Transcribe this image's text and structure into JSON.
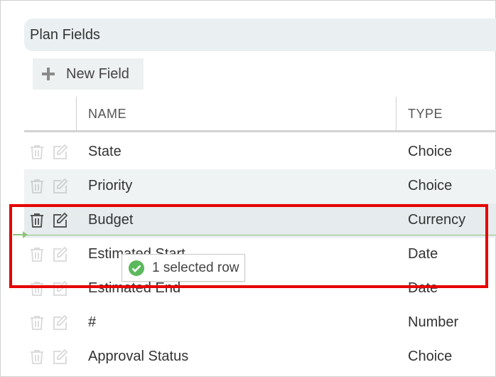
{
  "section": {
    "title": "Plan Fields"
  },
  "toolbar": {
    "new_field_label": "New Field"
  },
  "table": {
    "columns": [
      {
        "label": "NAME"
      },
      {
        "label": "TYPE"
      }
    ],
    "rows": [
      {
        "name": "State",
        "type": "Choice"
      },
      {
        "name": "Priority",
        "type": "Choice"
      },
      {
        "name": "Budget",
        "type": "Currency"
      },
      {
        "name": "Estimated Start",
        "type": "Date"
      },
      {
        "name": "Estimated End",
        "type": "Date"
      },
      {
        "name": "#",
        "type": "Number"
      },
      {
        "name": "Approval Status",
        "type": "Choice"
      }
    ]
  },
  "drag": {
    "tooltip": "1 selected row"
  },
  "icons": {
    "row_actions": [
      "trash-icon",
      "edit-icon"
    ],
    "add": "plus-icon",
    "tooltip": "check-circle-icon"
  },
  "colors": {
    "highlight": "#e60000",
    "drop_indicator": "#8fc37b",
    "check": "#5cb85c",
    "row_alt": "#eff3f4"
  }
}
